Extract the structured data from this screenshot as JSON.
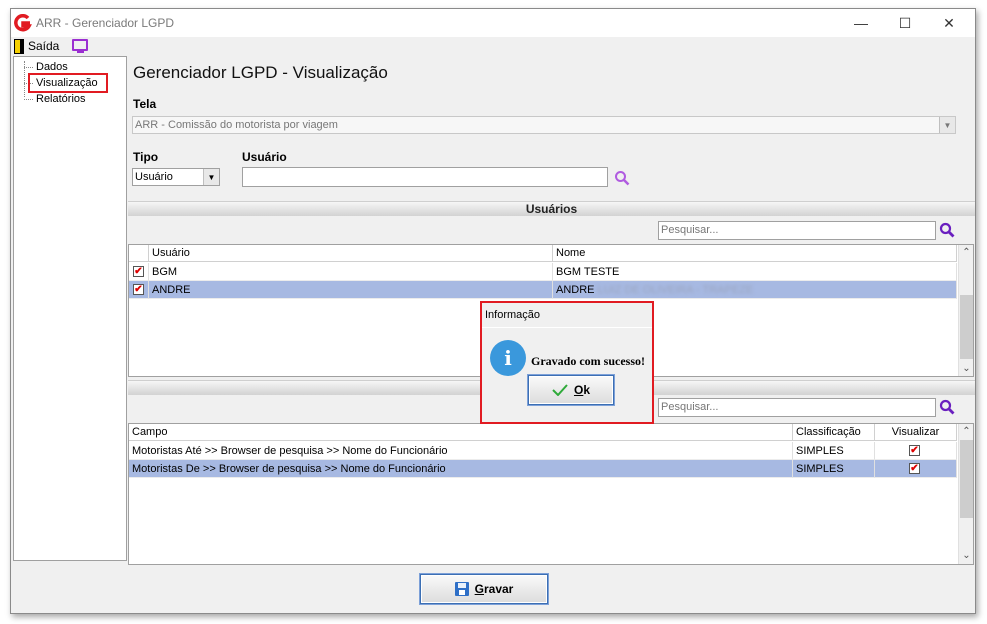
{
  "window": {
    "title": "ARR - Gerenciador LGPD",
    "minimize_glyph": "—",
    "maximize_glyph": "☐",
    "close_glyph": "✕",
    "logo_icon": "g-logo-icon",
    "accent_color": "#e11b22"
  },
  "menu": {
    "exit_label": "Saída",
    "exit_icon": "door-icon",
    "screen_icon": "monitor-icon"
  },
  "tree": {
    "items": [
      {
        "label": "Dados"
      },
      {
        "label": "Visualização",
        "selected": true
      },
      {
        "label": "Relatórios"
      }
    ]
  },
  "page": {
    "title": "Gerenciador LGPD - Visualização",
    "tela_label": "Tela",
    "tela_value": "ARR - Comissão do motorista por viagem",
    "tipo_label": "Tipo",
    "tipo_value": "Usuário",
    "usuario_label": "Usuário",
    "usuario_value": ""
  },
  "users_section": {
    "title": "Usuários",
    "search_placeholder": "Pesquisar...",
    "columns": [
      "Usuário",
      "Nome"
    ],
    "rows": [
      {
        "checked": true,
        "usuario": "BGM",
        "nome": "BGM TESTE",
        "nome_hidden": "",
        "selected": false
      },
      {
        "checked": true,
        "usuario": "ANDRE",
        "nome": "ANDRE",
        "nome_hidden": "LUIZ DE OLIVEIRA - TRAPEZE",
        "selected": true
      }
    ]
  },
  "fields_section": {
    "search_placeholder": "Pesquisar...",
    "columns": [
      "Campo",
      "Classificação",
      "Visualizar"
    ],
    "rows": [
      {
        "campo": "Motoristas Até >> Browser de pesquisa >> Nome do Funcionário",
        "classificacao": "SIMPLES",
        "visualizar": true,
        "selected": false
      },
      {
        "campo": "Motoristas De >> Browser de pesquisa >> Nome do Funcionário",
        "classificacao": "SIMPLES",
        "visualizar": true,
        "selected": true
      }
    ]
  },
  "dialog": {
    "title": "Informação",
    "icon": "info-icon",
    "message": "Gravado com sucesso!",
    "ok_label": "Ok",
    "ok_icon": "check-icon"
  },
  "footer": {
    "save_label": "Gravar",
    "save_icon": "floppy-icon"
  }
}
